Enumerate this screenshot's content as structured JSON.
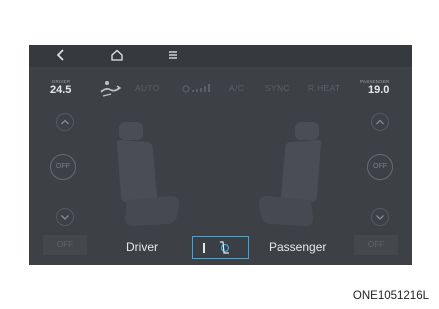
{
  "icons": {
    "back": "back-arrow-icon",
    "home": "home-icon",
    "menu": "menu-icon",
    "airflow": "airflow-mode-icon",
    "fan": "fan-speed-icon",
    "seat": "seat-climate-icon"
  },
  "status": {
    "driver_label": "DRIVER",
    "driver_temp": "24.5",
    "passenger_label": "PASSENGER",
    "passenger_temp": "19.0",
    "auto": "AUTO",
    "ac": "A/C",
    "sync": "SYNC",
    "rheat": "R.HEAT"
  },
  "controls": {
    "left_off": "OFF",
    "right_off": "OFF",
    "bottom_left_off": "OFF",
    "bottom_right_off": "OFF"
  },
  "tabs": {
    "driver": "Driver",
    "passenger": "Passenger"
  },
  "colors": {
    "screen_bg": "#3d4045",
    "selection": "#3aa7e5"
  },
  "caption": "ONE1051216L"
}
